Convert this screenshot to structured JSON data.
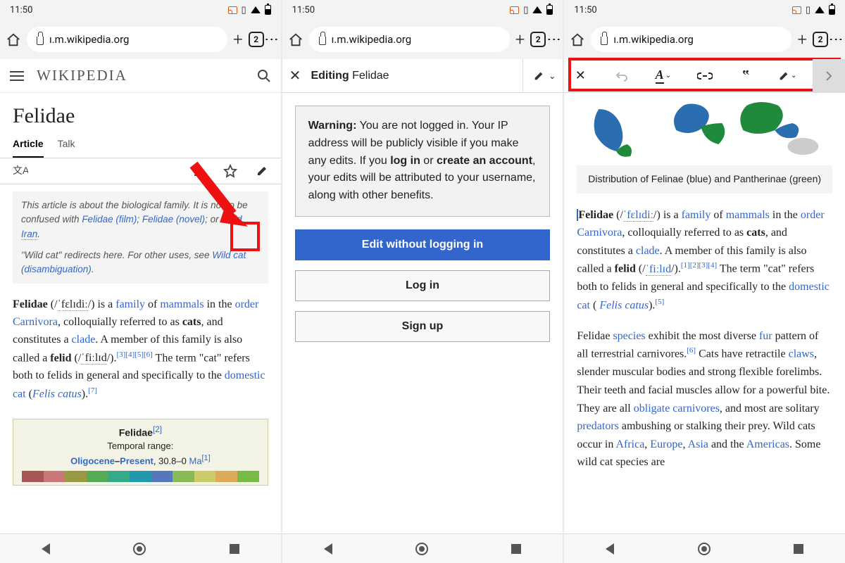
{
  "status": {
    "time": "11:50",
    "tabcount": "2"
  },
  "browser": {
    "url": "ı.m.wikipedia.org"
  },
  "phone1": {
    "logo": "WIKIPEDIA",
    "title": "Felidae",
    "tabs": {
      "article": "Article",
      "talk": "Talk"
    },
    "hatnote": {
      "line1a": "This article is about the biological family. It is not to be confused with ",
      "link1": "Felidae (film)",
      "sep1": "; ",
      "link2": "Felidae (novel)",
      "sep2": "; or ",
      "link3": "Felid",
      "sep3": ", ",
      "link4": "Iran",
      "end1": ".",
      "line2a": "\"Wild cat\" redirects here. For other uses, see ",
      "link5": "Wild cat (disambiguation)",
      "end2": "."
    },
    "body": {
      "t1": "Felidae",
      "t2": " (/",
      "ipa1": "ˈfɛlɪdiː",
      "t3": "/) is a ",
      "a_family": "family",
      "t4": " of ",
      "a_mammals": "mammals",
      "t5": " in the ",
      "a_order": "order Carnivora",
      "t6": ", colloquially referred to as ",
      "b_cats": "cats",
      "t7": ", and constitutes a ",
      "a_clade": "clade",
      "t8": ". A member of this family is also called a ",
      "b_felid": "felid",
      "t9": " (/",
      "ipa2": "ˈfiːlɪd",
      "t10": "/).",
      "refs1": "[3][4][5][6]",
      "t11": " The term \"cat\" refers both to felids in general and specifically to the ",
      "a_dcat": "domestic cat",
      "t12": " (",
      "i_felis": "Felis catus",
      "t13": ").",
      "ref7": "[7]"
    },
    "infobox": {
      "title": "Felidae",
      "ref2": "[2]",
      "label": "Temporal range:",
      "a_olig": "Oligocene",
      "dash": "–",
      "a_pres": "Present",
      "val": ", 30.8–0 ",
      "a_ma": "Ma",
      "ref1": "[1]"
    }
  },
  "phone2": {
    "editing": "Editing",
    "page": " Felidae",
    "warn_b": "Warning:",
    "warn_1": " You are not logged in. Your IP address will be publicly visible if you make any edits. If you ",
    "warn_login": "log in",
    "warn_or": " or ",
    "warn_create": "create an account",
    "warn_2": ", your edits will be attributed to your username, along with other benefits.",
    "btn_edit": "Edit without logging in",
    "btn_login": "Log in",
    "btn_signup": "Sign up"
  },
  "phone3": {
    "caption": "Distribution of Felinae (blue) and Pantherinae (green)",
    "p1": {
      "t1": "Felidae",
      "t2": " (/",
      "ipa1": "ˈfɛlɪdiː",
      "t3": "/) is a ",
      "a_family": "family",
      "t4": " of ",
      "a_mammals": "mammals",
      "t5": " in the ",
      "a_order": "order",
      "t5b": " ",
      "a_carn": "Carnivora",
      "t6": ", colloquially referred to as ",
      "b_cats": "cats",
      "t7": ", and constitutes a ",
      "a_clade": "clade",
      "t8": ". A member of this family is also called a ",
      "b_felid": "felid",
      "t9": " (/",
      "ipa2": "ˈfiːlɪd",
      "t10": "/).",
      "refs1a": "[1]",
      "refs1b": "[2]",
      "refs1c": "[3]",
      "refs1d": "[4]",
      "t11": " The term \"cat\" refers both to felids in general and specifically to the ",
      "a_dcat": "domestic cat",
      "t12": " ( ",
      "i_felis": "Felis catus",
      "t13": ").",
      "ref5": "[5]"
    },
    "p2": {
      "t1": "Felidae ",
      "a_species": "species",
      "t2": " exhibit the most diverse ",
      "a_fur": "fur",
      "t3": " pattern of all terrestrial carnivores.",
      "ref6": "[6]",
      "t4": " Cats have retractile ",
      "a_claws": "claws",
      "t5": ", slender muscular bodies and strong flexible forelimbs. Their teeth and facial muscles allow for a powerful bite. They are all ",
      "a_oblig": "obligate carnivores",
      "t6": ", and most are solitary ",
      "a_pred": "predators",
      "t7": " ambushing or stalking their prey. Wild cats occur in ",
      "a_af": "Africa",
      "c1": ", ",
      "a_eu": "Europe",
      "c2": ", ",
      "a_as": "Asia",
      "t8": " and the ",
      "a_am": "Americas",
      "t9": ". Some wild cat species are"
    }
  }
}
